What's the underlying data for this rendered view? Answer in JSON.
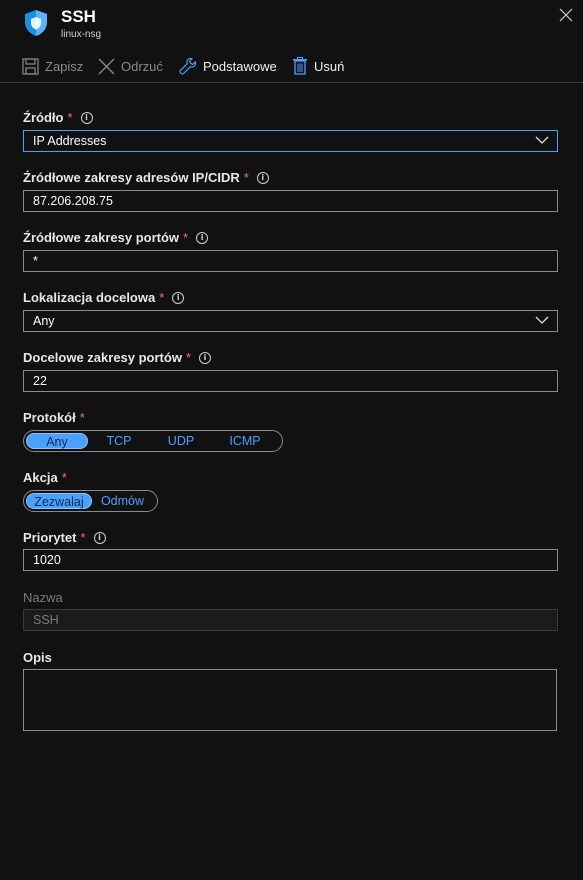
{
  "header": {
    "title": "SSH",
    "subtitle": "linux-nsg"
  },
  "toolbar": {
    "save": "Zapisz",
    "discard": "Odrzuć",
    "basic": "Podstawowe",
    "delete": "Usuń"
  },
  "form": {
    "source": {
      "label": "Źródło",
      "value": "IP Addresses"
    },
    "source_cidr": {
      "label": "Źródłowe zakresy adresów IP/CIDR",
      "value": "87.206.208.75"
    },
    "source_ports": {
      "label": "Źródłowe zakresy portów",
      "value": "*"
    },
    "destination": {
      "label": "Lokalizacja docelowa",
      "value": "Any"
    },
    "dest_ports": {
      "label": "Docelowe zakresy portów",
      "value": "22"
    },
    "protocol": {
      "label": "Protokół",
      "options": [
        "Any",
        "TCP",
        "UDP",
        "ICMP"
      ],
      "selected": "Any"
    },
    "action": {
      "label": "Akcja",
      "options": [
        "Zezwalaj",
        "Odmów"
      ],
      "selected": "Zezwalaj"
    },
    "priority": {
      "label": "Priorytet",
      "value": "1020"
    },
    "name": {
      "label": "Nazwa",
      "value": "SSH"
    },
    "description": {
      "label": "Opis",
      "value": ""
    }
  },
  "required_mark": "*",
  "info_glyph": "i",
  "colors": {
    "accent": "#4aa0ff",
    "required": "#f1707b",
    "background": "#111111"
  },
  "icons": [
    "shield-icon",
    "close-icon",
    "save-icon",
    "discard-icon",
    "wrench-icon",
    "trash-icon",
    "info-icon",
    "chevron-down-icon"
  ]
}
